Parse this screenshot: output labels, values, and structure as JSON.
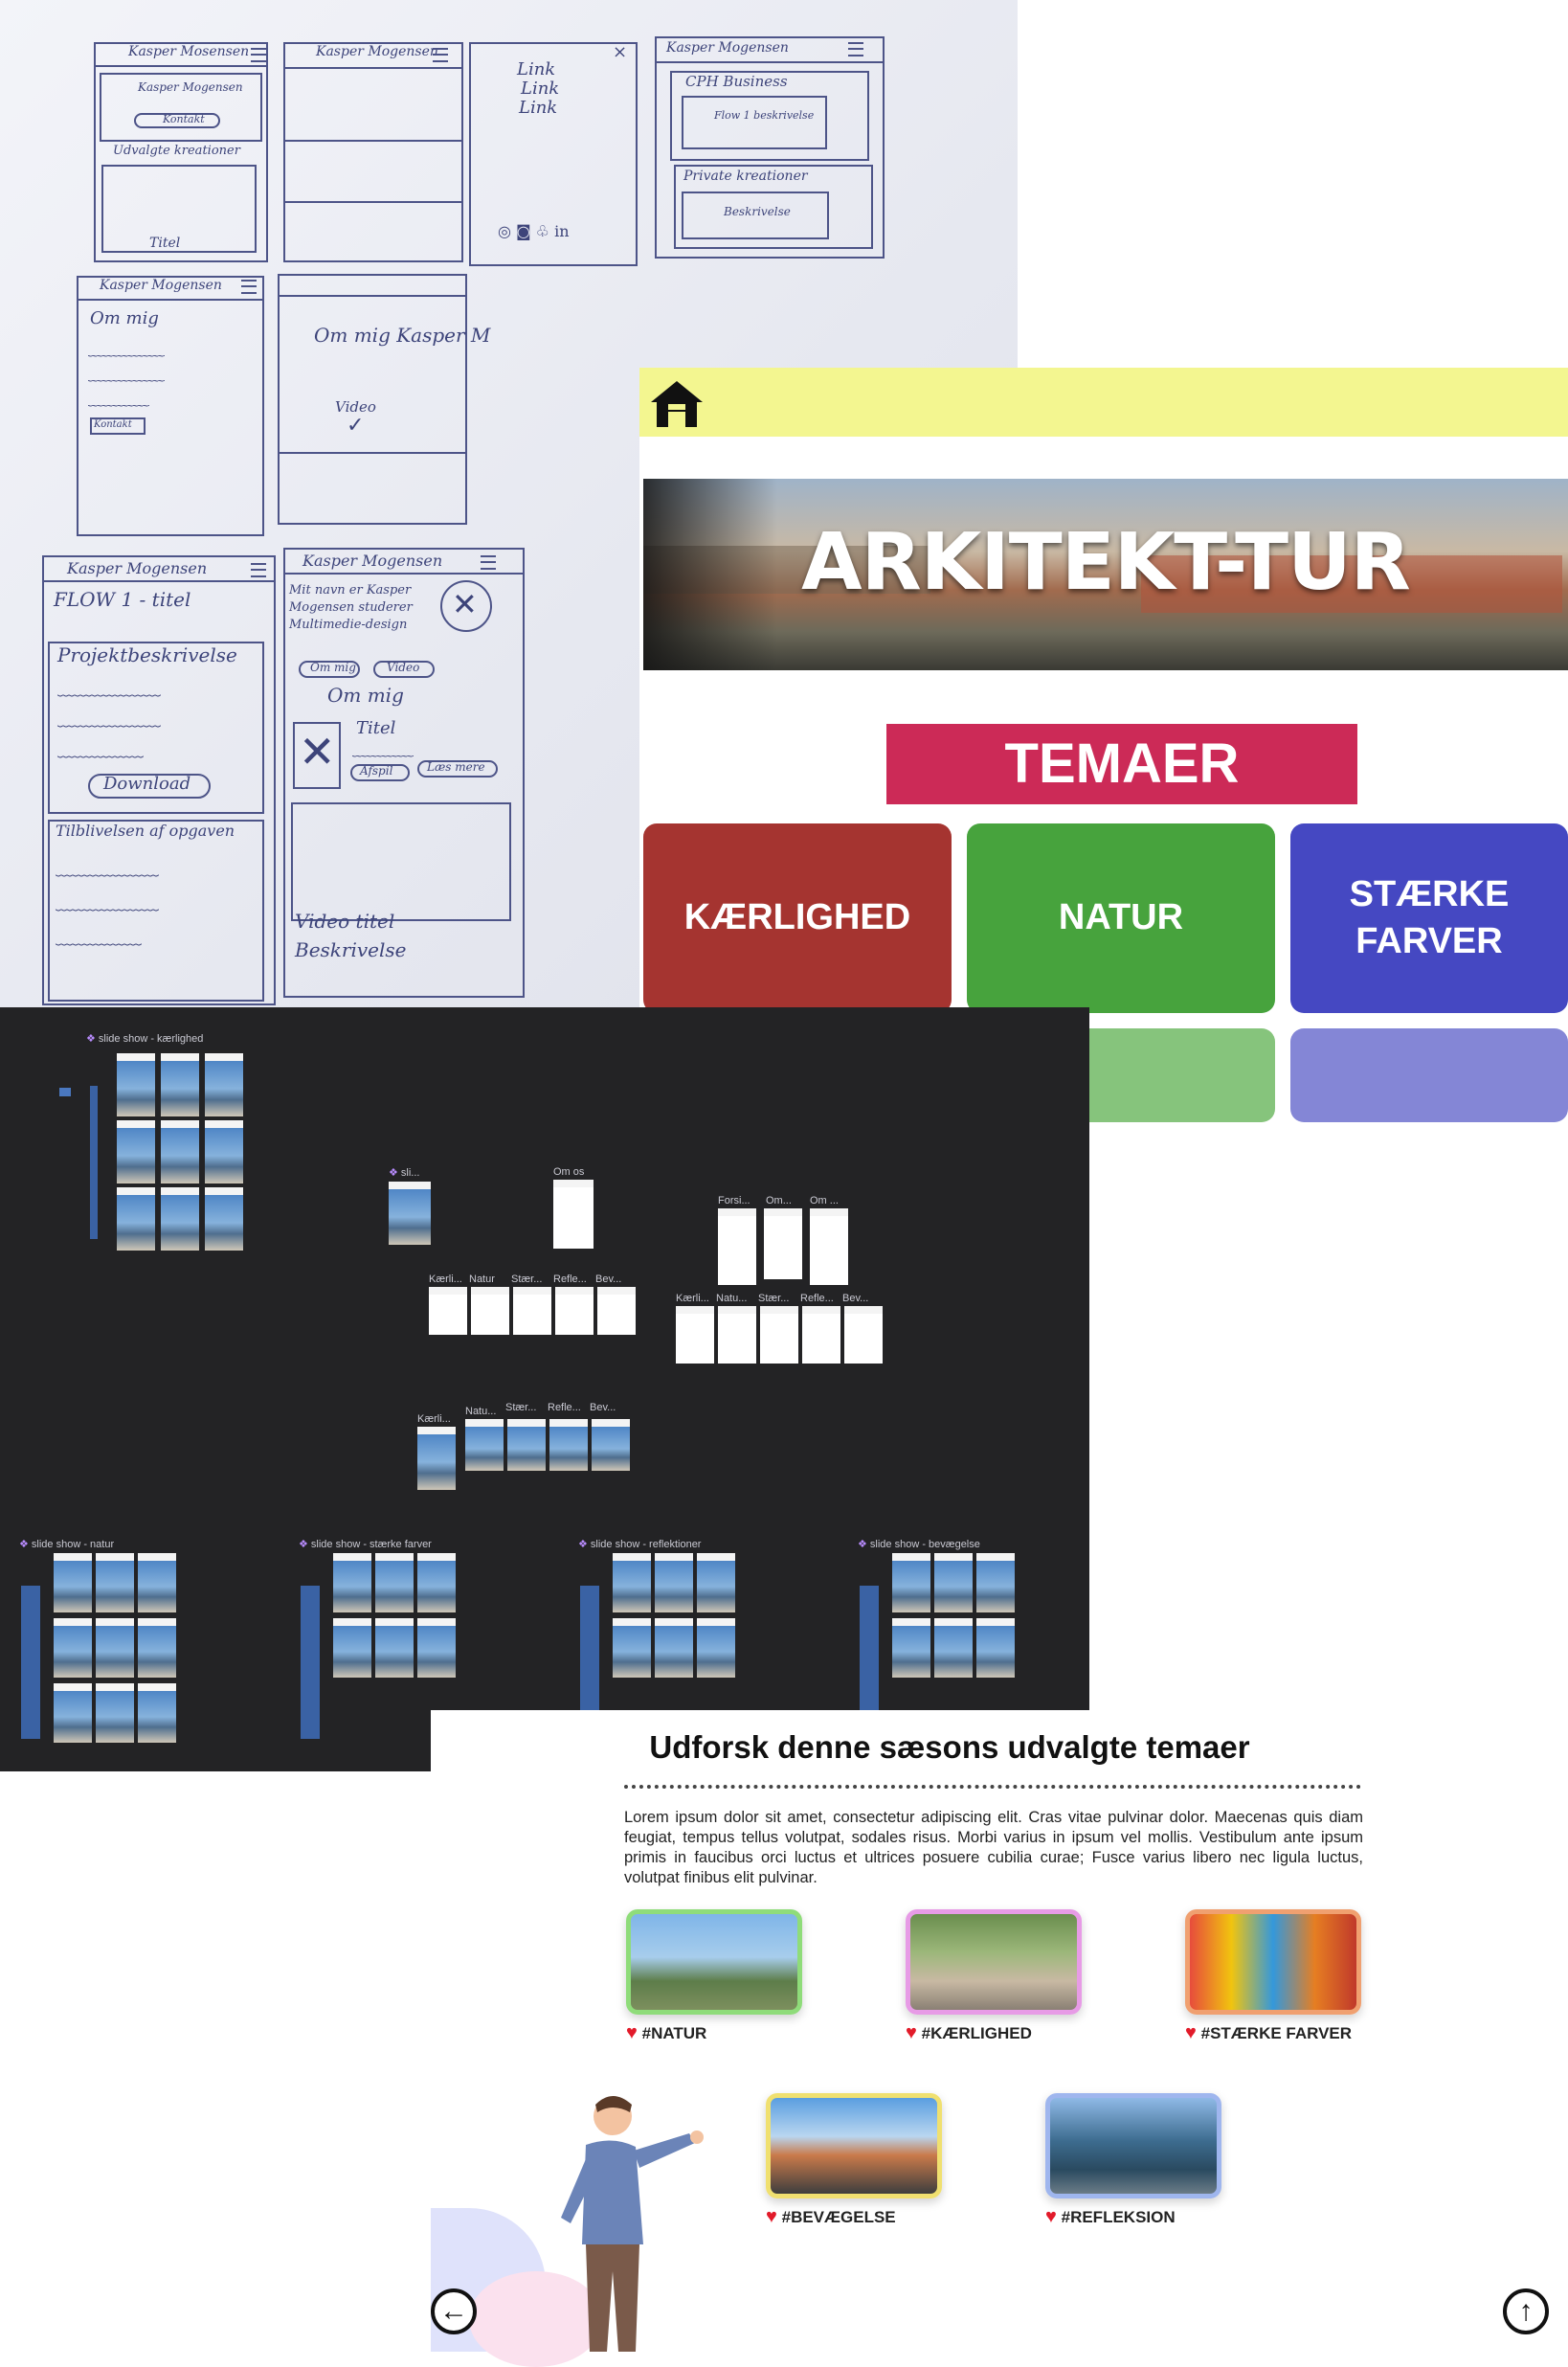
{
  "sketch": {
    "titles": [
      "Kasper Mosensen",
      "Kasper Mogensen",
      "Kasper Mogensen",
      "Kasper Mogensen",
      "Kasper Mogensen",
      "Kasper Mogensen"
    ],
    "hero_text": "Kasper Mogensen",
    "hero_button": "Kontakt",
    "section_udvalgte": "Udvalgte kreationer",
    "titel": "Titel",
    "links": [
      "Link",
      "Link",
      "Link"
    ],
    "cph_business": "CPH Business",
    "flow_beskrivelse": "Flow 1 beskrivelse",
    "private_kreationer": "Private kreationer",
    "beskrivelse": "Beskrivelse",
    "om_mig": "Om mig",
    "om_mig_kasper": "Om mig Kasper M",
    "video": "Video",
    "kontakt": "Kontakt",
    "flow_titel": "FLOW 1 - titel",
    "projektbeskrivelse": "Projektbeskrivelse",
    "download": "Download",
    "tilblivelsen": "Tilblivelsen af opgaven",
    "mit_navn": "Mit navn er Kasper Mogensen studerer Multimedie-design",
    "om_mig_btn": "Om mig",
    "video_btn": "Video",
    "om_mig_2": "Om mig",
    "titel_2": "Titel",
    "afspil": "Afspil",
    "laes_mere": "Læs mere",
    "video_titel": "Video titel",
    "beskrivelse_2": "Beskrivelse"
  },
  "app": {
    "brand_title": "ARKITEKT-TUR",
    "section_heading": "TEMAER",
    "tiles": [
      {
        "label": "KÆRLIGHED",
        "color": "#a53430"
      },
      {
        "label": "NATUR",
        "color": "#47a33d"
      },
      {
        "label": "STÆRKE FARVER",
        "color": "#4548c2"
      }
    ],
    "partial_tiles_colors": [
      "#86c47c",
      "#8486d6"
    ]
  },
  "canvas": {
    "slide_shows": [
      "slide show - kærlighed",
      "slide show - natur",
      "slide show - stærke farver",
      "slide show - reflektioner",
      "slide show - bevægelse"
    ],
    "labels": {
      "sli": "sli...",
      "om_os": "Om os",
      "forsi": "Forsi...",
      "om": "Om...",
      "om2": "Om ...",
      "row1": [
        "Kærli...",
        "Natur",
        "Stær...",
        "Refle...",
        "Bev..."
      ],
      "row2": [
        "Kærli...",
        "Natu...",
        "Stær...",
        "Refle...",
        "Bev..."
      ],
      "row3": [
        "Kærli...",
        "Natu...",
        "Stær...",
        "Refle...",
        "Bev..."
      ]
    }
  },
  "themes": {
    "title": "Udforsk denne sæsons udvalgte temaer",
    "body": "Lorem ipsum dolor sit amet, consectetur adipiscing elit. Cras vitae pulvinar dolor. Maecenas quis diam feugiat, tempus tellus volutpat, sodales risus. Morbi varius in ipsum vel mollis. Vestibulum ante ipsum primis in faucibus orci luctus et ultrices posuere cubilia curae; Fusce varius libero nec ligula luctus, volutpat finibus elit pulvinar.",
    "cards": [
      {
        "tag": "#NATUR",
        "border": "#8fdc7a"
      },
      {
        "tag": "#KÆRLIGHED",
        "border": "#e79be6"
      },
      {
        "tag": "#STÆRKE FARVER",
        "border": "#f0a070"
      },
      {
        "tag": "#BEVÆGELSE",
        "border": "#f0e070"
      },
      {
        "tag": "#REFLEKSION",
        "border": "#9fb6ee"
      }
    ],
    "back_icon": "arrow-left-icon",
    "up_icon": "arrow-up-icon"
  }
}
